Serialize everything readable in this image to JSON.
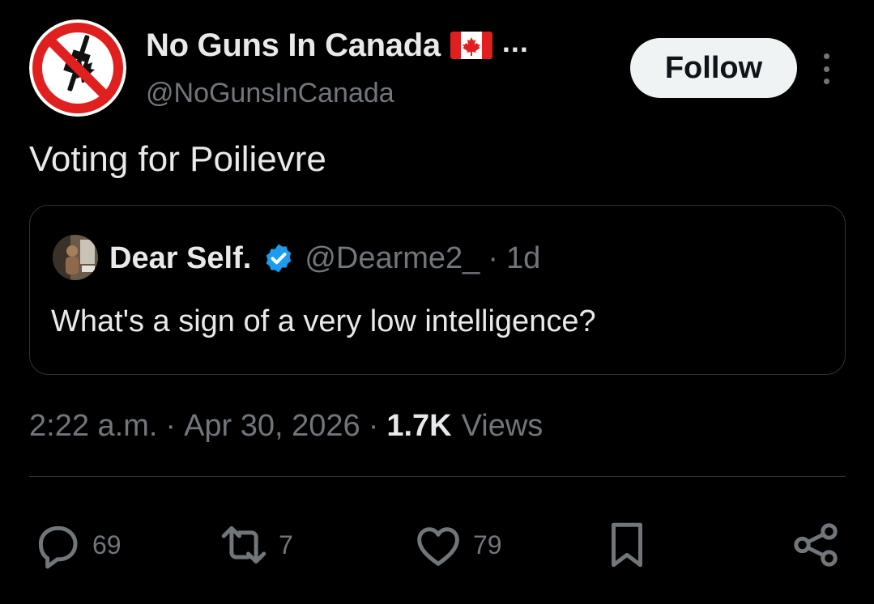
{
  "author": {
    "display_name": "No Guns In Canada",
    "flag_emoji": "flag-canada-icon",
    "truncation": "...",
    "handle": "@NoGunsInCanada",
    "avatar_icon": "no-guns-sign-icon"
  },
  "actions_top": {
    "follow_label": "Follow",
    "more_icon": "more-vertical-icon"
  },
  "tweet": {
    "text": "Voting for Poilievre"
  },
  "quoted": {
    "display_name": "Dear Self.",
    "verified_icon": "verified-badge-icon",
    "handle": "@Dearme2_",
    "separator": "·",
    "relative_time": "1d",
    "text": "What's a sign of a very low intelligence?"
  },
  "meta": {
    "time": "2:22 a.m.",
    "separator": "·",
    "date": "Apr 30, 2026",
    "views_count": "1.7K",
    "views_label": "Views"
  },
  "engagement": {
    "replies": "69",
    "reposts": "7",
    "likes": "79"
  },
  "colors": {
    "background": "#000000",
    "primary_text": "#e7e9ea",
    "secondary_text": "#71767b",
    "border": "#2f3336",
    "verified_blue": "#1d9bf0",
    "follow_bg": "#eff3f4",
    "prohibit_red": "#e0201f"
  }
}
